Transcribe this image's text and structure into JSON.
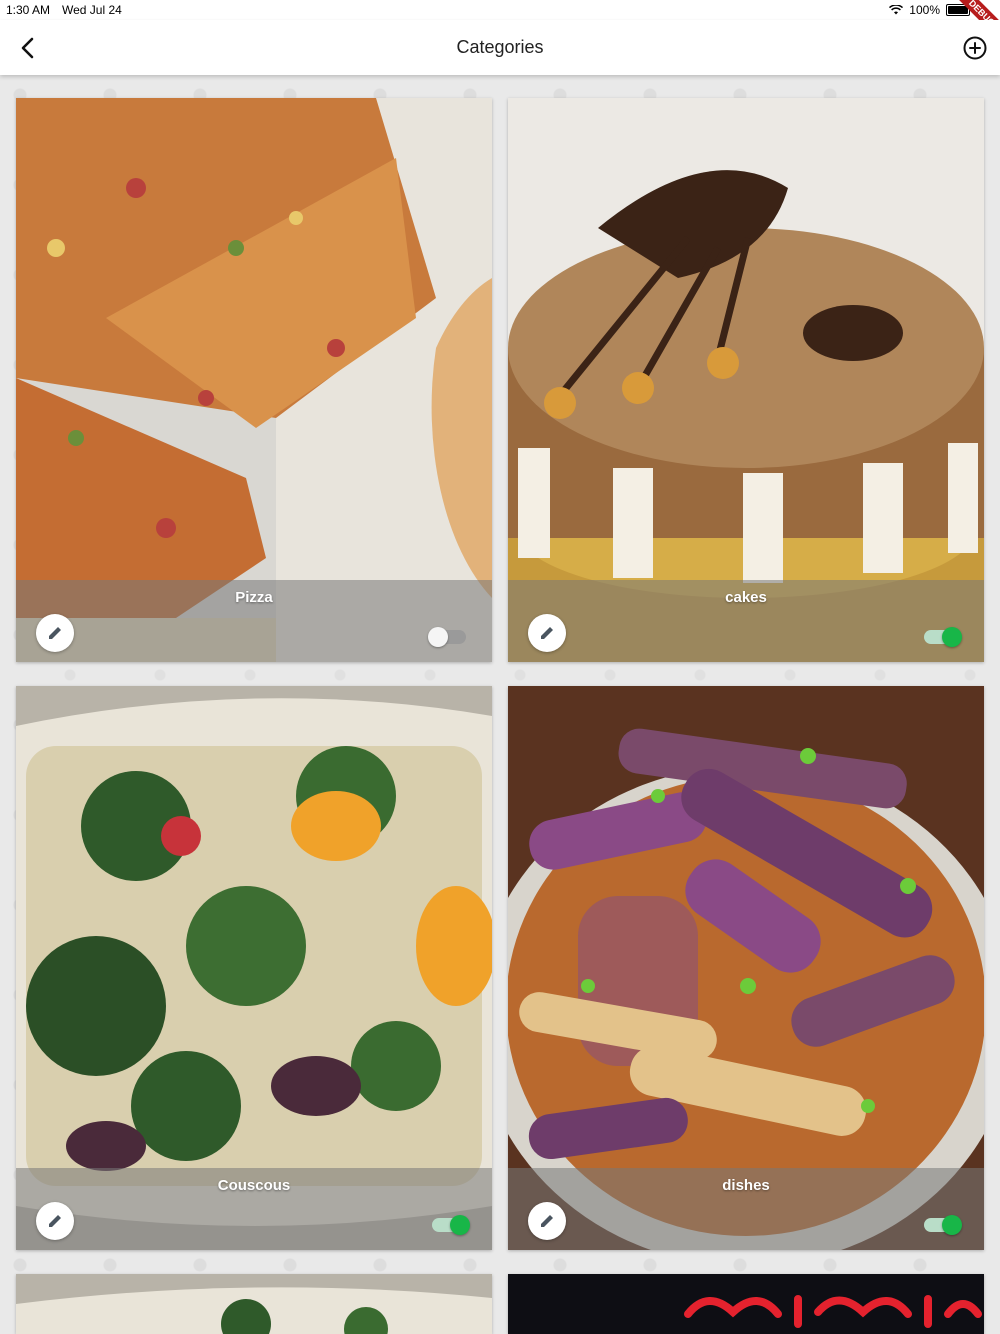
{
  "status_bar": {
    "time": "1:30 AM",
    "date": "Wed Jul 24",
    "battery": "100%",
    "debug": "DEBUG"
  },
  "app_bar": {
    "title": "Categories"
  },
  "categories": [
    {
      "label": "Pizza",
      "enabled": false
    },
    {
      "label": "cakes",
      "enabled": true
    },
    {
      "label": "Couscous",
      "enabled": true
    },
    {
      "label": "dishes",
      "enabled": true
    },
    {
      "label": "",
      "enabled": true
    },
    {
      "label": "",
      "enabled": true
    }
  ],
  "icons": {
    "back": "chevron-left-icon",
    "add": "add-circle-icon",
    "edit": "pencil-icon",
    "wifi": "wifi-icon",
    "battery": "battery-icon"
  },
  "colors": {
    "toggle_on": "#18b648",
    "toggle_off": "#9a9a9a",
    "debug_ribbon": "#b71c1c"
  }
}
